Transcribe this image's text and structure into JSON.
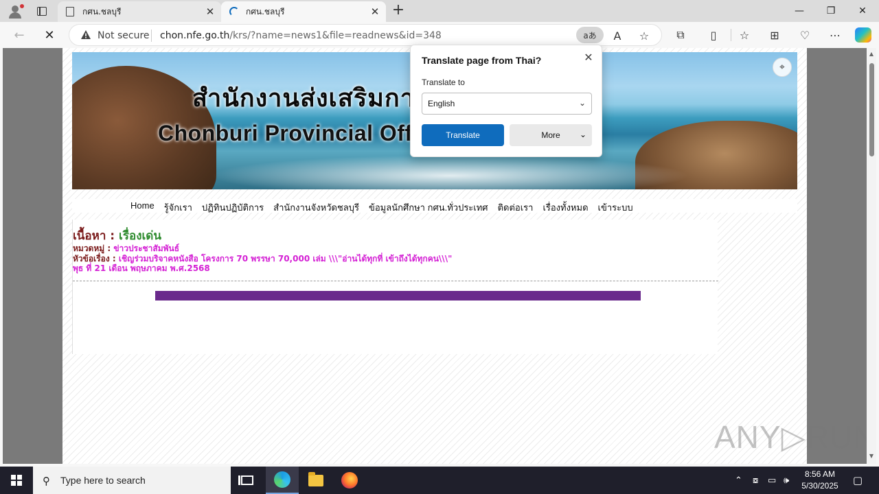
{
  "browser": {
    "tabs": [
      {
        "title": "กศน.ชลบุรี",
        "active": false
      },
      {
        "title": "กศน.ชลบุรี",
        "active": true
      }
    ],
    "new_tab": "+",
    "window_controls": {
      "minimize": "—",
      "restore": "❐",
      "close": "✕"
    },
    "address": {
      "security_label": "Not secure",
      "host": "chon.nfe.go.th",
      "path": "/krs/?name=news1&file=readnews&id=348",
      "translate_badge": "aあ"
    }
  },
  "translate_popup": {
    "title": "Translate page from Thai?",
    "label": "Translate to",
    "selected_language": "English",
    "translate_button": "Translate",
    "more_button": "More"
  },
  "site": {
    "banner_th": "สำนักงานส่งเสริมการ                          วัดชลบุรี",
    "banner_en": "Chonburi Provincial Offic                           couragement",
    "menu": [
      "Home",
      "รู้จักเรา",
      "ปฏิทินปฏิบัติการ",
      "สำนักงานจังหวัดชลบุรี",
      "ข้อมูลนักศึกษา กศน.ทั่วประเทศ",
      "ติดต่อเรา",
      "เรื่องทั้งหมด",
      "เข้าระบบ"
    ],
    "content": {
      "title_label": "เนื้อหา :",
      "title_value": "เรื่องเด่น",
      "category_label": "หมวดหมู่ :",
      "category_value": "ข่าวประชาสัมพันธ์",
      "subject_label": "หัวข้อเรื่อง :",
      "subject_value": "เชิญร่วมบริจาคหนังสือ โครงการ 70 พรรษา 70,000 เล่ม \\\\\\\"อ่านได้ทุกที่ เข้าถึงได้ทุกคน\\\\\\\"",
      "date": "พุธ ที่ 21 เดือน พฤษภาคม พ.ศ.2568"
    },
    "watermark": "ANY▷RUN"
  },
  "taskbar": {
    "search_placeholder": "Type here to search",
    "time": "8:56 AM",
    "date": "5/30/2025"
  },
  "colors": {
    "accent": "#0f6cbd",
    "title_red": "#7a1a1a",
    "title_green": "#2e8b2e",
    "magenta": "#d41fd4",
    "purple_bar": "#6a2a8c"
  }
}
